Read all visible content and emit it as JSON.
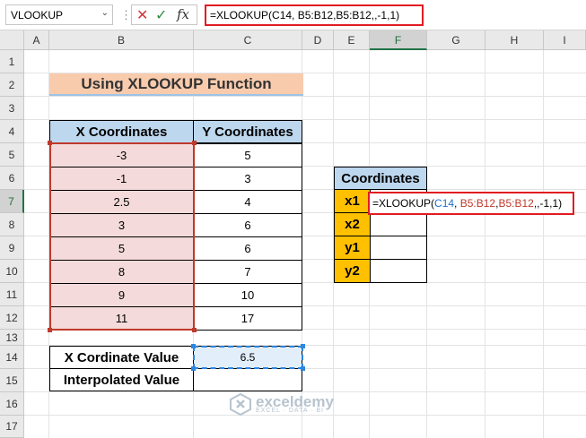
{
  "formula_bar": {
    "name_box": "VLOOKUP",
    "name_box_icon": "chevron-down-icon",
    "more_icon": "vertical-dots-icon",
    "cancel_icon": "close-icon",
    "confirm_icon": "check-icon",
    "function_icon": "fx",
    "formula": "=XLOOKUP(C14, B5:B12,B5:B12,,-1,1)"
  },
  "columns": [
    "A",
    "B",
    "C",
    "D",
    "E",
    "F",
    "G",
    "H",
    "I"
  ],
  "selected_column": "F",
  "rows": [
    "1",
    "2",
    "3",
    "4",
    "5",
    "6",
    "7",
    "8",
    "9",
    "10",
    "11",
    "12",
    "13",
    "14",
    "15",
    "16",
    "17"
  ],
  "selected_row": "7",
  "title": "Using XLOOKUP Function",
  "table": {
    "headers": [
      "X Coordinates",
      "Y Coordinates"
    ],
    "x_values": [
      "-3",
      "-1",
      "2.5",
      "3",
      "5",
      "8",
      "9",
      "11"
    ],
    "y_values": [
      "5",
      "3",
      "4",
      "6",
      "6",
      "7",
      "10",
      "17"
    ]
  },
  "lookup": {
    "x_label": "X Cordinate Value",
    "x_value": "6.5",
    "interp_label": "Interpolated Value",
    "interp_value": ""
  },
  "coordinates": {
    "header": "Coordinates",
    "labels": [
      "x1",
      "x2",
      "y1",
      "y2"
    ]
  },
  "edit_formula": {
    "prefix": "=XLOOKUP(",
    "ref1": "C14",
    "sep1": ", ",
    "ref2": "B5:B12",
    "sep2": ",",
    "ref3": "B5:B12",
    "suffix": ",,-1,1)"
  },
  "watermark": {
    "brand": "exceldemy",
    "tagline": "EXCEL · DATA · BI"
  },
  "colors": {
    "title_bg": "#f8cbad",
    "header_bg": "#bdd7ee",
    "x_cells_bg": "#f4dada",
    "coord_label_bg": "#ffc000",
    "edit_border": "#e11b22"
  }
}
